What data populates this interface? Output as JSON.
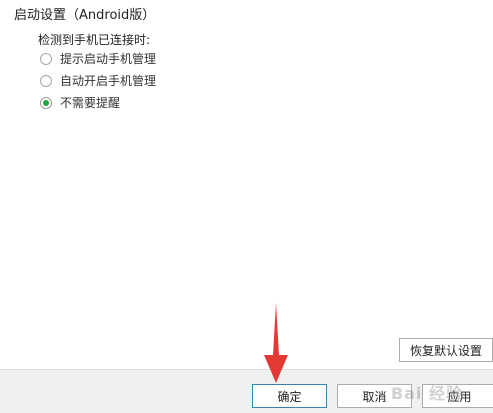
{
  "settings": {
    "section_title": "启动设置（Android版）",
    "group_label": "检测到手机已连接时:",
    "options": [
      {
        "label": "提示启动手机管理",
        "checked": false
      },
      {
        "label": "自动开启手机管理",
        "checked": false
      },
      {
        "label": "不需要提醒",
        "checked": true
      }
    ]
  },
  "buttons": {
    "restore_default": "恢复默认设置",
    "ok": "确定",
    "cancel": "取消",
    "apply": "应用"
  },
  "annotation": {
    "arrow_color": "#e53935"
  },
  "watermark": "Bai 经验"
}
